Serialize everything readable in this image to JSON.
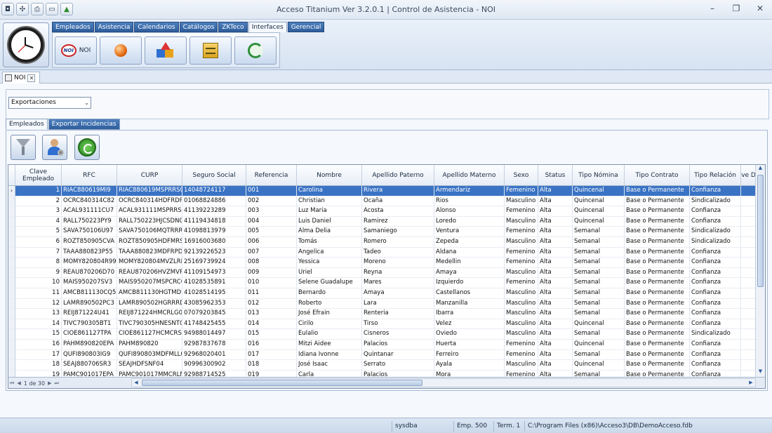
{
  "window": {
    "title": "Acceso Titanium  Ver 3.2.0.1 | Control de Asistencia - NOI"
  },
  "ribbon": {
    "tabs": [
      "Empleados",
      "Asistencia",
      "Calendarios",
      "Catálogos",
      "ZKTeco",
      "Interfaces",
      "Gerencial"
    ],
    "active_tab": "Interfaces",
    "buttons": {
      "noi_label": "NOI"
    }
  },
  "document_tab": {
    "label": "NOI"
  },
  "export_combo": {
    "value": "Exportaciones"
  },
  "subtabs": [
    "Empleados",
    "Exportar Incidencias"
  ],
  "grid": {
    "columns": [
      "Clave Empleado",
      "RFC",
      "CURP",
      "Seguro Social",
      "Referencia",
      "Nombre",
      "Apellido Paterno",
      "Apellido Materno",
      "Sexo",
      "Status",
      "Tipo Nómina",
      "Tipo Contrato",
      "Tipo Relación",
      "Clave Departam"
    ],
    "rows": [
      [
        "1",
        "RIAC880619MI9",
        "RIAC880619MSPRRS0",
        "14048724117",
        "001",
        "Carolina",
        "Rivera",
        "Armendariz",
        "Femenino",
        "Alta",
        "Quincenal",
        "Base o Permanente",
        "Confianza"
      ],
      [
        "2",
        "OCRC840314C82",
        "OCRC840314HDFRDR0",
        "01068824886",
        "002",
        "Christian",
        "Ocaña",
        "Rios",
        "Masculino",
        "Alta",
        "Quincenal",
        "Base o Permanente",
        "Sindicalizado"
      ],
      [
        "3",
        "ACAL931111CU7",
        "ACAL931111MSPRRS0",
        "41139223289",
        "003",
        "Luz Maria",
        "Acosta",
        "Alonso",
        "Femenino",
        "Alta",
        "Quincenal",
        "Base o Permanente",
        "Confianza"
      ],
      [
        "4",
        "RALL750223PY9",
        "RALL750223HJCSDN02",
        "41119434818",
        "004",
        "Luis Daniel",
        "Ramirez",
        "Loredo",
        "Masculino",
        "Alta",
        "Quincenal",
        "Base o Permanente",
        "Confianza"
      ],
      [
        "5",
        "SAVA750106U97",
        "SAVA750106MQTRRR2",
        "41098813979",
        "005",
        "Alma Delia",
        "Samaniego",
        "Ventura",
        "Femenino",
        "Alta",
        "Semanal",
        "Base o Permanente",
        "Sindicalizado"
      ],
      [
        "6",
        "ROZT850905CVA",
        "ROZT850905HDFMRS0",
        "16916003680",
        "006",
        "Tomás",
        "Romero",
        "Zepeda",
        "Masculino",
        "Alta",
        "Semanal",
        "Base o Permanente",
        "Sindicalizado"
      ],
      [
        "7",
        "TAAA880823P55",
        "TAAA880823MDFRPD1",
        "92139226523",
        "007",
        "Angelica",
        "Tadeo",
        "Aldana",
        "Femenino",
        "Alta",
        "Semanal",
        "Base o Permanente",
        "Confianza"
      ],
      [
        "8",
        "MOMY820804R99",
        "MOMY820804MVZLRR0",
        "25169739924",
        "008",
        "Yessica",
        "Moreno",
        "Medellin",
        "Femenino",
        "Alta",
        "Semanal",
        "Base o Permanente",
        "Confianza"
      ],
      [
        "9",
        "REAU870206D70",
        "REAU870206HVZMVR0",
        "41109154973",
        "009",
        "Uriel",
        "Reyna",
        "Amaya",
        "Masculino",
        "Alta",
        "Semanal",
        "Base o Permanente",
        "Confianza"
      ],
      [
        "10",
        "MAIS950207SV3",
        "MAIS950207MSPCRC0",
        "41028535891",
        "010",
        "Selene Guadalupe",
        "Mares",
        "Izquierdo",
        "Femenino",
        "Alta",
        "Semanal",
        "Base o Permanente",
        "Confianza"
      ],
      [
        "11",
        "AMCB811130CQ5",
        "AMCB811130HGTMDR0",
        "41028514195",
        "011",
        "Bernardo",
        "Amaya",
        "Castellanos",
        "Masculino",
        "Alta",
        "Semanal",
        "Base o Permanente",
        "Confianza"
      ],
      [
        "12",
        "LAMR890502PC3",
        "LAMR890502HGRRRD0",
        "43085962353",
        "012",
        "Roberto",
        "Lara",
        "Manzanilla",
        "Masculino",
        "Alta",
        "Semanal",
        "Base o Permanente",
        "Confianza"
      ],
      [
        "13",
        "REIJ871224U41",
        "REIJ871224HMCRLG03",
        "07079203845",
        "013",
        "José Efrain",
        "Renteria",
        "Ibarra",
        "Masculino",
        "Alta",
        "Semanal",
        "Base o Permanente",
        "Confianza"
      ],
      [
        "14",
        "TIVC790305BT1",
        "TIVC790305HNESNT05",
        "41748425455",
        "014",
        "Cirilo",
        "Tirso",
        "Velez",
        "Masculino",
        "Alta",
        "Quincenal",
        "Base o Permanente",
        "Confianza"
      ],
      [
        "15",
        "CIOE861127TPA",
        "CIOE861127HCMCRS0",
        "94988014497",
        "015",
        "Eulalio",
        "Cisneros",
        "Oviedo",
        "Masculino",
        "Alta",
        "Semanal",
        "Base o Permanente",
        "Sindicalizado"
      ],
      [
        "16",
        "PAHM890820EPA",
        "PAHM890820",
        "92987837678",
        "016",
        "Mitzi Aidee",
        "Palacios",
        "Huerta",
        "Femenino",
        "Alta",
        "Quincenal",
        "Base o Permanente",
        "Confianza"
      ],
      [
        "17",
        "QUFI890803IG9",
        "QUFI890803MDFMLL0",
        "92968020401",
        "017",
        "Idiana Ivonne",
        "Quintanar",
        "Ferreiro",
        "Femenino",
        "Alta",
        "Semanal",
        "Base o Permanente",
        "Confianza"
      ],
      [
        "18",
        "SEAJ880706SR3",
        "SEAJHDFSNF04",
        "90996300902",
        "018",
        "José Isaac",
        "Serrato",
        "Ayala",
        "Masculino",
        "Alta",
        "Quincenal",
        "Base o Permanente",
        "Confianza"
      ],
      [
        "19",
        "PAMC901017EPA",
        "PAMC901017MMCRLN0",
        "92988714525",
        "019",
        "Carla",
        "Palacios",
        "Mora",
        "Femenino",
        "Alta",
        "Semanal",
        "Base o Permanente",
        "Confianza"
      ]
    ],
    "selected_row": 0,
    "pager": "1 de 30"
  },
  "statusbar": {
    "user": "sysdba",
    "emp": "Emp. 500",
    "term": "Term. 1",
    "path": "C:\\Program Files (x86)\\Acceso3\\DB\\DemoAcceso.fdb"
  }
}
